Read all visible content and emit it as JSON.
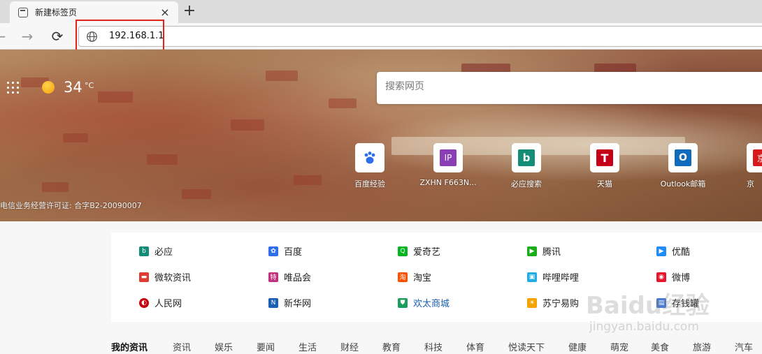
{
  "tab": {
    "title": "新建标签页",
    "close": "×",
    "new_tab": "+"
  },
  "toolbar": {
    "back": "←",
    "forward": "→",
    "refresh": "⟳",
    "address": "192.168.1.1"
  },
  "hero": {
    "temperature": "34",
    "temperature_unit": "°C",
    "search_placeholder": "搜索网页",
    "icp": "电信业务经营许可证: 合字B2-20090007",
    "tiles": [
      {
        "label": "百度经验",
        "icon": "baidu-paw-icon",
        "color": "#2f6ee8"
      },
      {
        "label": "ZXHN F663N...",
        "icon": "ip-letter-icon",
        "glyph": "IP",
        "color": "#8a3fb5"
      },
      {
        "label": "必应搜索",
        "icon": "bing-icon",
        "glyph": "b",
        "color": "#138d75"
      },
      {
        "label": "天猫",
        "icon": "tmall-icon",
        "glyph": "T",
        "color": "#c40018"
      },
      {
        "label": "Outlook邮箱",
        "icon": "outlook-icon",
        "glyph": "O",
        "color": "#0f6cbd"
      },
      {
        "label": "京",
        "icon": "jd-icon",
        "glyph": "京",
        "color": "#d71c1e"
      }
    ]
  },
  "links": [
    {
      "label": "必应",
      "icon": "bing-icon",
      "glyph": "b",
      "color": "#138d75"
    },
    {
      "label": "百度",
      "icon": "baidu-paw-icon",
      "glyph": "✿",
      "color": "#2f6ee8"
    },
    {
      "label": "爱奇艺",
      "icon": "iqiyi-icon",
      "glyph": "Q",
      "color": "#00b51d"
    },
    {
      "label": "腾讯",
      "icon": "tencent-play-icon",
      "glyph": "▶",
      "color": "#1aad19"
    },
    {
      "label": "优酷",
      "icon": "youku-icon",
      "glyph": "▶",
      "color": "#1f8bff"
    },
    {
      "label": "微软资讯",
      "icon": "msn-news-icon",
      "glyph": "▬",
      "color": "#e03c31"
    },
    {
      "label": "唯品会",
      "icon": "vip-icon",
      "glyph": "特",
      "color": "#c3307e"
    },
    {
      "label": "淘宝",
      "icon": "taobao-icon",
      "glyph": "淘",
      "color": "#ff5000"
    },
    {
      "label": "哔哩哔哩",
      "icon": "bilibili-icon",
      "glyph": "▣",
      "color": "#23ade5"
    },
    {
      "label": "微博",
      "icon": "weibo-icon",
      "glyph": "◉",
      "color": "#e6162d"
    },
    {
      "label": "人民网",
      "icon": "people-icon",
      "glyph": "◐",
      "color": "#c7000b"
    },
    {
      "label": "新华网",
      "icon": "xinhua-icon",
      "glyph": "N",
      "color": "#1a5fb4"
    },
    {
      "label": "欢太商城",
      "icon": "heytap-store-icon",
      "glyph": "⛊",
      "color": "#1b9d5b",
      "highlight": true
    },
    {
      "label": "苏宁易购",
      "icon": "suning-icon",
      "glyph": "☀",
      "color": "#f5a300"
    },
    {
      "label": "存钱罐",
      "icon": "piggy-icon",
      "glyph": "▤",
      "color": "#4a7bd6"
    }
  ],
  "news_tabs": [
    "我的资讯",
    "资讯",
    "娱乐",
    "要闻",
    "生活",
    "财经",
    "教育",
    "科技",
    "体育",
    "悦读天下",
    "健康",
    "萌宠",
    "美食",
    "旅游",
    "汽车"
  ],
  "watermark": {
    "brand": "Baidu经验",
    "url": "jingyan.baidu.com"
  }
}
